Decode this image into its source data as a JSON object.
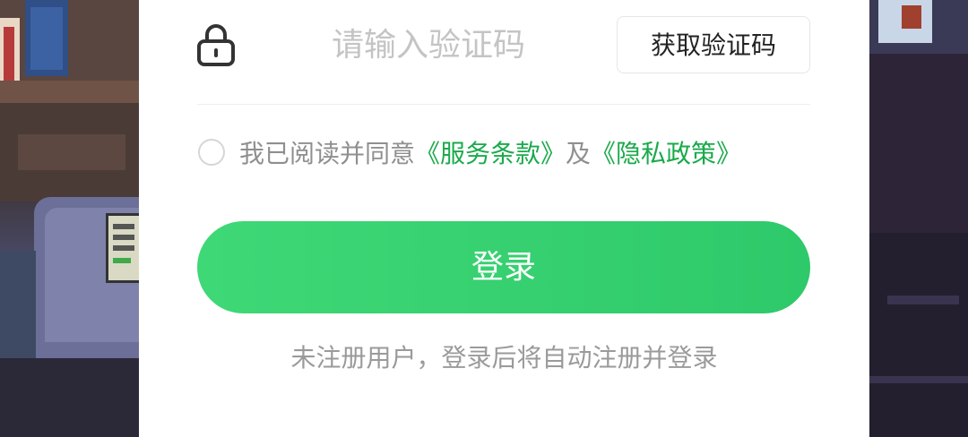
{
  "code_field": {
    "placeholder": "请输入验证码",
    "lock_icon": "lock-icon"
  },
  "get_code_button": {
    "label": "获取验证码"
  },
  "agreement": {
    "prefix": "我已阅读并同意",
    "terms_link": "《服务条款》",
    "conjunction": "及",
    "privacy_link": "《隐私政策》",
    "checked": false
  },
  "login_button": {
    "label": "登录"
  },
  "hint_text": "未注册用户，登录后将自动注册并登录",
  "colors": {
    "accent_green": "#2ec96a",
    "link_green": "#1aaa4b",
    "placeholder_gray": "#c4c4c4",
    "hint_gray": "#9a9a9a"
  }
}
